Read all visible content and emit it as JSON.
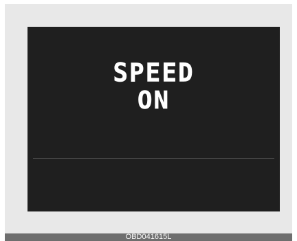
{
  "display": {
    "line1": "SPEED",
    "line2": "ON"
  },
  "caption": {
    "code": "OBD041615L"
  },
  "colors": {
    "screen_background": "#1f1f1f",
    "frame_background": "#e8e8e8",
    "text": "#ffffff",
    "caption_bar": "#6e6e6e"
  }
}
